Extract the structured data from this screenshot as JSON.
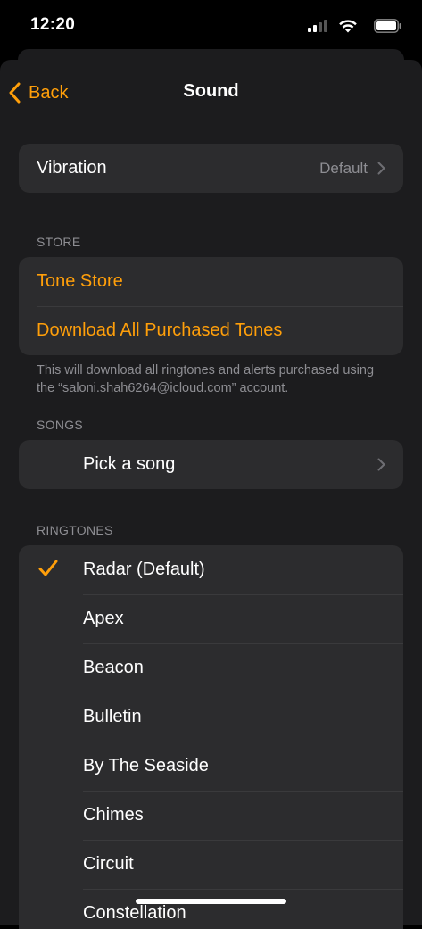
{
  "status": {
    "time": "12:20"
  },
  "nav": {
    "back_label": "Back",
    "title": "Sound"
  },
  "vibration": {
    "label": "Vibration",
    "value": "Default"
  },
  "store": {
    "header": "STORE",
    "tone_store": "Tone Store",
    "download_all": "Download All Purchased Tones",
    "footer": "This will download all ringtones and alerts purchased using the “saloni.shah6264@icloud.com” account."
  },
  "songs": {
    "header": "SONGS",
    "pick": "Pick a song"
  },
  "ringtones": {
    "header": "RINGTONES",
    "selected_index": 0,
    "items": [
      "Radar (Default)",
      "Apex",
      "Beacon",
      "Bulletin",
      "By The Seaside",
      "Chimes",
      "Circuit",
      "Constellation"
    ]
  },
  "colors": {
    "accent": "#ff9f0a",
    "background": "#1c1c1e",
    "cell": "#2c2c2e",
    "secondary_text": "#8e8e93"
  },
  "icons": [
    "back-chevron-icon",
    "chevron-right-icon",
    "checkmark-icon",
    "signal-icon",
    "wifi-icon",
    "battery-icon"
  ]
}
